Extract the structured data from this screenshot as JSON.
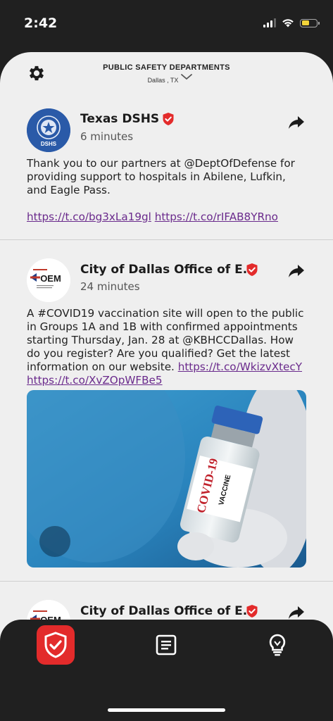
{
  "status_bar": {
    "time": "2:42"
  },
  "header": {
    "title": "PUBLIC SAFETY DEPARTMENTS",
    "location": "Dallas , TX"
  },
  "posts": [
    {
      "author": "Texas DSHS",
      "time": "6 minutes",
      "avatar_text": "DSHS",
      "body": "Thank you to our partners at @DeptOfDefense for providing support to hospitals in Abilene, Lufkin, and Eagle Pass.",
      "links": [
        "https://t.co/bg3xLa19gl",
        "https://t.co/rIFAB8YRno"
      ]
    },
    {
      "author": "City of Dallas Office of E...",
      "time": "24 minutes",
      "avatar_text": "OEM",
      "body": "A #COVID19 vaccination site will open to the public in Groups 1A and 1B with confirmed appointments starting Thursday, Jan. 28 at @KBHCCDallas. How do you register? Are you qualified? Get the latest information on our website.",
      "links": [
        "https://t.co/WkizvXtecY",
        "https://t.co/XvZOpWFBe5"
      ],
      "image_label_1": "COVID-19",
      "image_label_2": "VACCINE"
    },
    {
      "author": "City of Dallas Office of E...",
      "avatar_text": "OEM"
    }
  ],
  "colors": {
    "accent": "#e32b2b",
    "link": "#6a2a8c",
    "sheet": "#efefef",
    "bar": "#202020"
  },
  "tabbar": {
    "tabs": [
      "shield-check-icon",
      "news-icon",
      "lightbulb-icon"
    ]
  }
}
